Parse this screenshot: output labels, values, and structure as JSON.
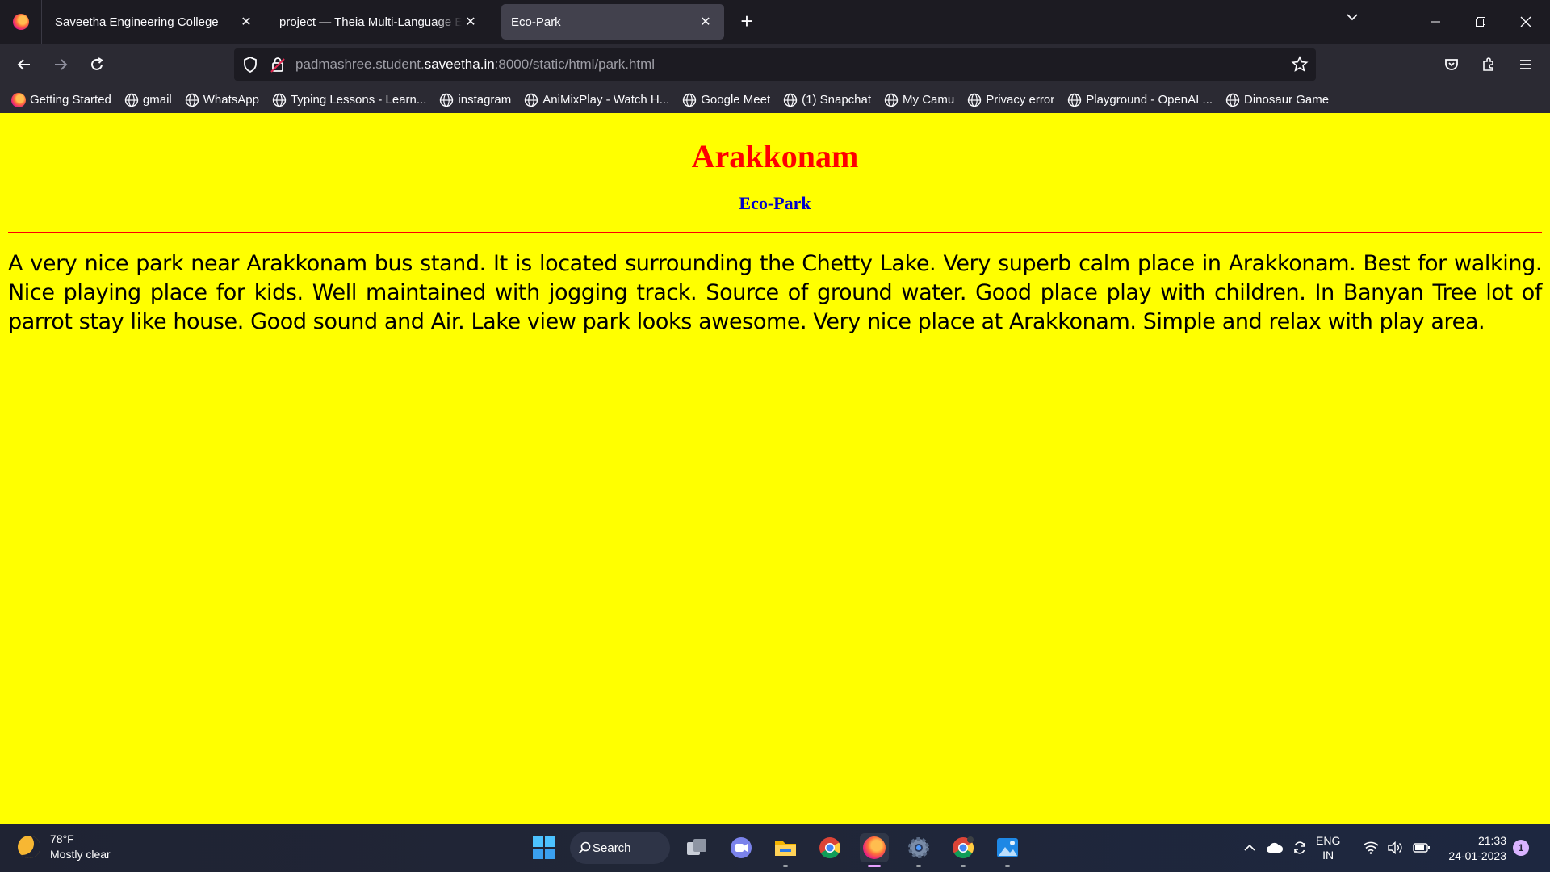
{
  "browser": {
    "tabs": [
      {
        "label": "Saveetha Engineering College",
        "active": false
      },
      {
        "label": "project — Theia Multi-Language Ex",
        "active": false
      },
      {
        "label": "Eco-Park",
        "active": true
      }
    ],
    "url": {
      "prefix": "padmashree.student.",
      "host": "saveetha.in",
      "suffix": ":8000/static/html/park.html"
    },
    "bookmarks": [
      "Getting Started",
      "gmail",
      "WhatsApp",
      "Typing Lessons - Learn...",
      "instagram",
      "AniMixPlay - Watch H...",
      "Google Meet",
      "(1) Snapchat",
      "My Camu",
      "Privacy error",
      "Playground - OpenAI ...",
      "Dinosaur Game"
    ]
  },
  "page": {
    "heading": "Arakkonam",
    "subheading": "Eco-Park",
    "paragraph": "A very nice park near Arakkonam bus stand. It is located surrounding the Chetty Lake. Very superb calm place in Arakkonam. Best for walking. Nice playing place for kids. Well maintained with jogging track. Source of ground water. Good place play with children. In Banyan Tree lot of parrot stay like house. Good sound and Air. Lake view park looks awesome. Very nice place at Arakkonam. Simple and relax with play area.",
    "colors": {
      "background": "#ffff00",
      "heading": "#ff0000",
      "subheading": "#0000cc",
      "rule": "#ff0000"
    }
  },
  "taskbar": {
    "weather": {
      "temp": "78°F",
      "condition": "Mostly clear"
    },
    "search_label": "Search",
    "language": {
      "line1": "ENG",
      "line2": "IN"
    },
    "clock": {
      "time": "21:33",
      "date": "24-01-2023"
    },
    "notification_count": "1"
  }
}
